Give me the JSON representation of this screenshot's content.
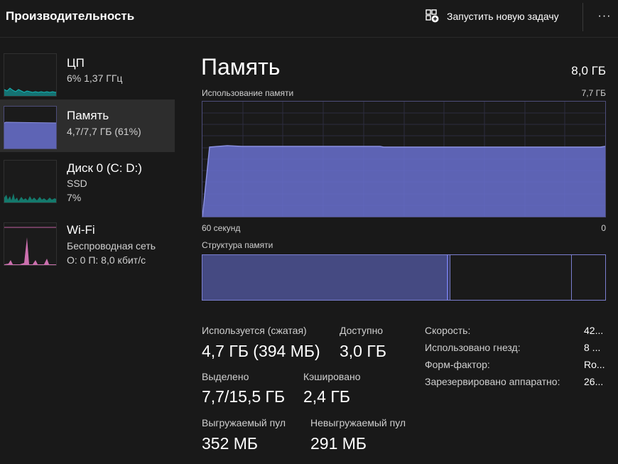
{
  "header": {
    "title": "Производительность",
    "run_task_label": "Запустить новую задачу",
    "more_label": "···"
  },
  "sidebar": {
    "items": [
      {
        "name": "ЦП",
        "line1": "6%  1,37 ГГц",
        "line2": "",
        "color": "#17b7b7"
      },
      {
        "name": "Память",
        "line1": "4,7/7,7 ГБ (61%)",
        "line2": "",
        "color": "#6a71d0",
        "selected": true
      },
      {
        "name": "Диск 0 (C: D:)",
        "line1": "SSD",
        "line2": "7%",
        "color": "#17b7a0"
      },
      {
        "name": "Wi-Fi",
        "line1": "Беспроводная сеть",
        "line2": "О: 0 П: 8,0 кбит/с",
        "color": "#e07ac0"
      }
    ]
  },
  "main": {
    "title": "Память",
    "total": "8,0 ГБ",
    "usage_label": "Использование памяти",
    "usage_max": "7,7 ГБ",
    "time_left": "60 секунд",
    "time_right": "0",
    "structure_label": "Структура памяти",
    "accent_color": "#6a71d0",
    "usage_fraction": 0.61
  },
  "stats": {
    "in_use_label": "Используется (сжатая)",
    "in_use_value": "4,7 ГБ (394 МБ)",
    "available_label": "Доступно",
    "available_value": "3,0 ГБ",
    "committed_label": "Выделено",
    "committed_value": "7,7/15,5 ГБ",
    "cached_label": "Кэшировано",
    "cached_value": "2,4 ГБ",
    "paged_label": "Выгружаемый пул",
    "paged_value": "352 МБ",
    "nonpaged_label": "Невыгружаемый пул",
    "nonpaged_value": "291 МБ"
  },
  "specs": [
    {
      "label": "Скорость:",
      "value": "42..."
    },
    {
      "label": "Использовано гнезд:",
      "value": "8 ..."
    },
    {
      "label": "Форм-фактор:",
      "value": "Ro..."
    },
    {
      "label": "Зарезервировано аппаратно:",
      "value": "26..."
    }
  ]
}
